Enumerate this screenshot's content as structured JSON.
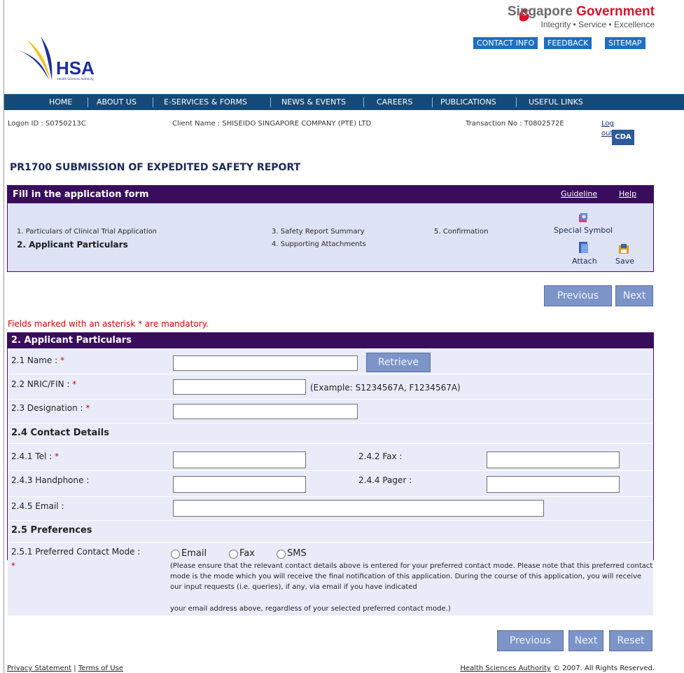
{
  "header": {
    "gov_title_part1": "Singapore",
    "gov_title_part2": "Government",
    "gov_tagline": "Integrity • Service • Excellence",
    "top_links": [
      "CONTACT INFO",
      "FEEDBACK",
      "SITEMAP"
    ],
    "logo_text": "HSA",
    "logo_subtext": "Health Sciences Authority"
  },
  "nav": {
    "items": [
      "HOME",
      "ABOUT US",
      "E-SERVICES & FORMS",
      "NEWS & EVENTS",
      "CAREERS",
      "PUBLICATIONS",
      "USEFUL LINKS"
    ]
  },
  "session": {
    "logon_id": "Logon ID : S0750213C",
    "client_name": "Client Name : SHISEIDO SINGAPORE COMPANY (PTE) LTD",
    "transaction_no": "Transaction No : T0802572E",
    "logout_line1": "Log",
    "logout_line2": "out",
    "cda": "CDA"
  },
  "page_title": "PR1700 SUBMISSION OF EXPEDITED SAFETY REPORT",
  "wizard": {
    "title": "Fill in the application form",
    "guideline": "Guideline",
    "help": "Help",
    "steps": [
      "1. Particulars of Clinical Trial Application",
      "2. Applicant Particulars",
      "3. Safety Report Summary",
      "4. Supporting Attachments",
      "5. Confirmation"
    ],
    "tools": {
      "special_symbol": "Special Symbol",
      "attach": "Attach",
      "save": "Save"
    }
  },
  "buttons": {
    "previous": "Previous",
    "next": "Next",
    "reset": "Reset",
    "retrieve": "Retrieve"
  },
  "mandatory_note": "Fields marked with an asterisk * are mandatory.",
  "form": {
    "title": "2. Applicant Particulars",
    "name_label": "2.1 Name :",
    "nric_label": "2.2 NRIC/FIN :",
    "nric_example": "(Example: S1234567A, F1234567A)",
    "designation_label": "2.3 Designation :",
    "contact_section": "2.4 Contact Details",
    "tel_label": "2.4.1 Tel :",
    "fax_label": "2.4.2 Fax :",
    "handphone_label": "2.4.3 Handphone :",
    "pager_label": "2.4.4 Pager :",
    "email_label": "2.4.5 Email :",
    "preferences_section": "2.5 Preferences",
    "contact_mode_label": "2.5.1 Preferred Contact Mode :",
    "required_mark": "*",
    "modes": [
      "Email",
      "Fax",
      "SMS"
    ],
    "note_1": "(Please ensure that the relevant contact details above is entered for your preferred contact mode. Please note that this preferred contact mode is the mode which you will receive the final notification of this application. During the course of this application, you will receive our input requests (i.e. queries), if any, via email if you have indicated",
    "note_2": "your email address above, regardless of your selected preferred contact mode.)"
  },
  "footer": {
    "privacy": "Privacy Statement",
    "terms": "Terms of Use",
    "hsa_link": "Health Sciences Authority",
    "copyright": " © 2007. All Rights Reserved."
  },
  "colors": {
    "nav": "#154a78",
    "header_purple": "#3a0d5c",
    "button": "#7d94c8",
    "required": "#d80000"
  }
}
